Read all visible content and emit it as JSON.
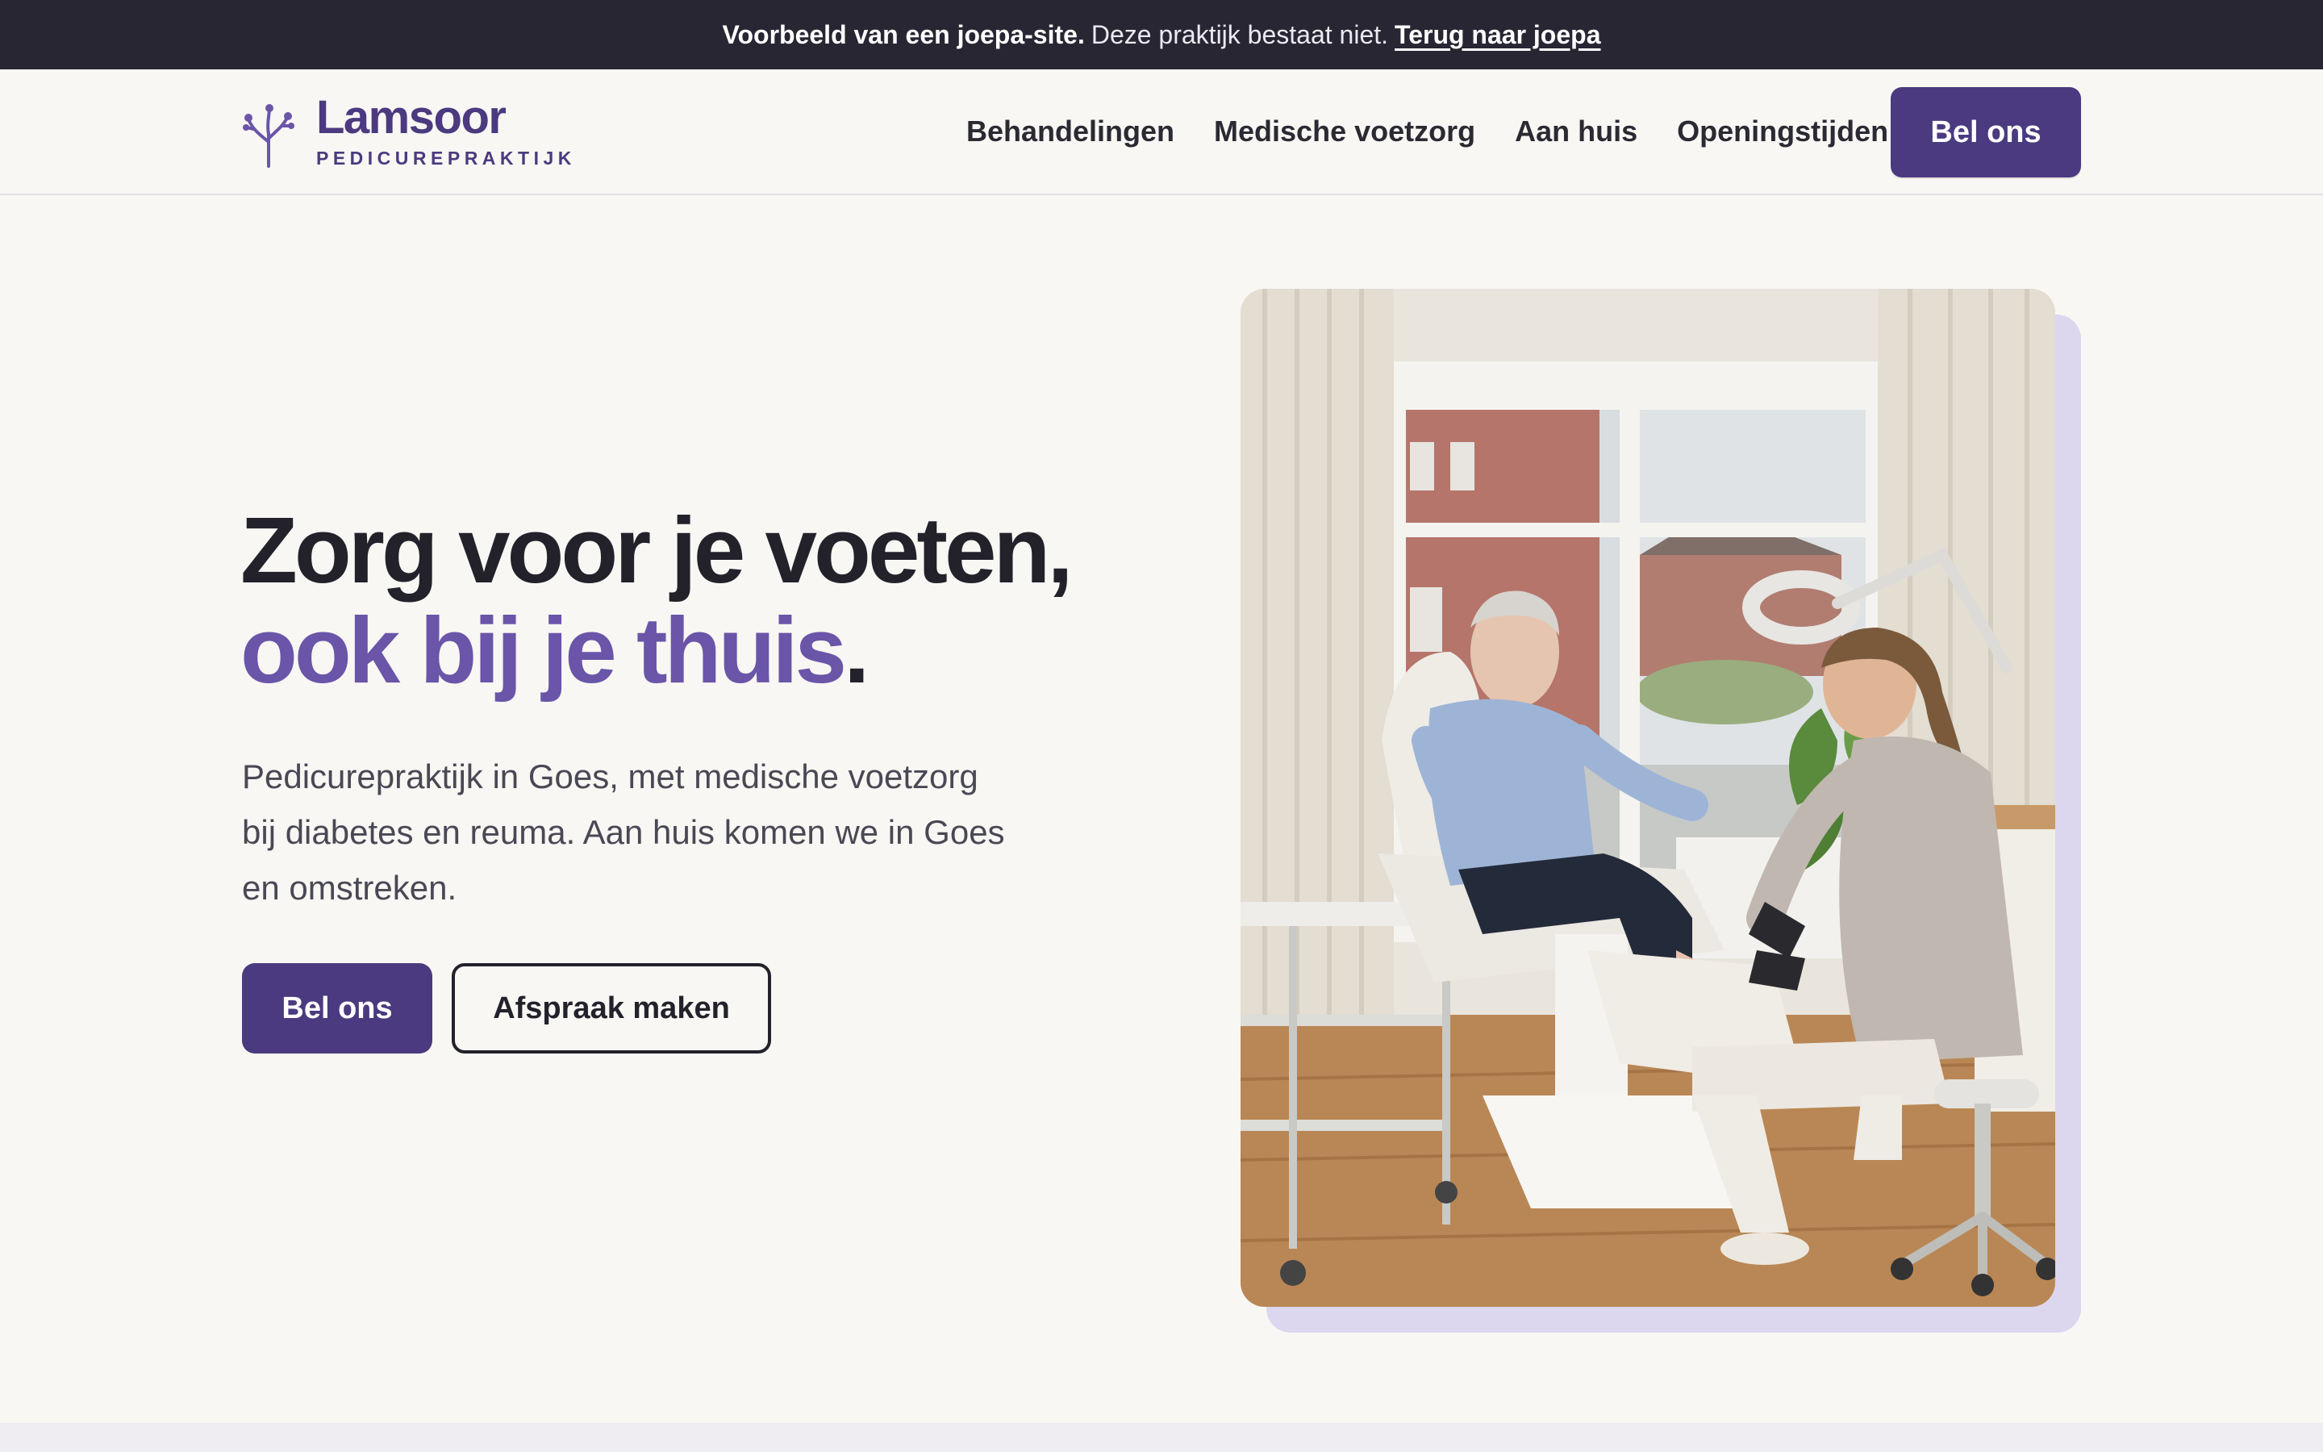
{
  "banner": {
    "bold_text": "Voorbeeld van een joepa-site.",
    "text": "Deze praktijk bestaat niet.",
    "link_text": "Terug naar joepa"
  },
  "brand": {
    "name": "Lamsoor",
    "subtitle": "PEDICUREPRAKTIJK",
    "logo_icon": "sea-lavender-sprig-icon"
  },
  "nav": {
    "items": [
      {
        "label": "Behandelingen"
      },
      {
        "label": "Medische voetzorg"
      },
      {
        "label": "Aan huis"
      },
      {
        "label": "Openingstijden"
      }
    ],
    "cta_label": "Bel ons"
  },
  "hero": {
    "title_line1": "Zorg voor je voeten,",
    "title_line2_accent": "ook bij je thuis",
    "title_line2_end": ".",
    "text_line1": "Pedicurepraktijk in Goes, met medische voetzorg",
    "text_line2": "bij diabetes en reuma. Aan huis komen we in Goes",
    "text_line3": "en omstreken.",
    "primary_button": "Bel ons",
    "secondary_button": "Afspraak maken"
  },
  "colors": {
    "brand_purple": "#4b3a7f",
    "accent_purple": "#6a55a8",
    "banner_bg": "#282633",
    "page_bg": "#f8f7f4",
    "photo_shadow": "#dcd6ee"
  }
}
